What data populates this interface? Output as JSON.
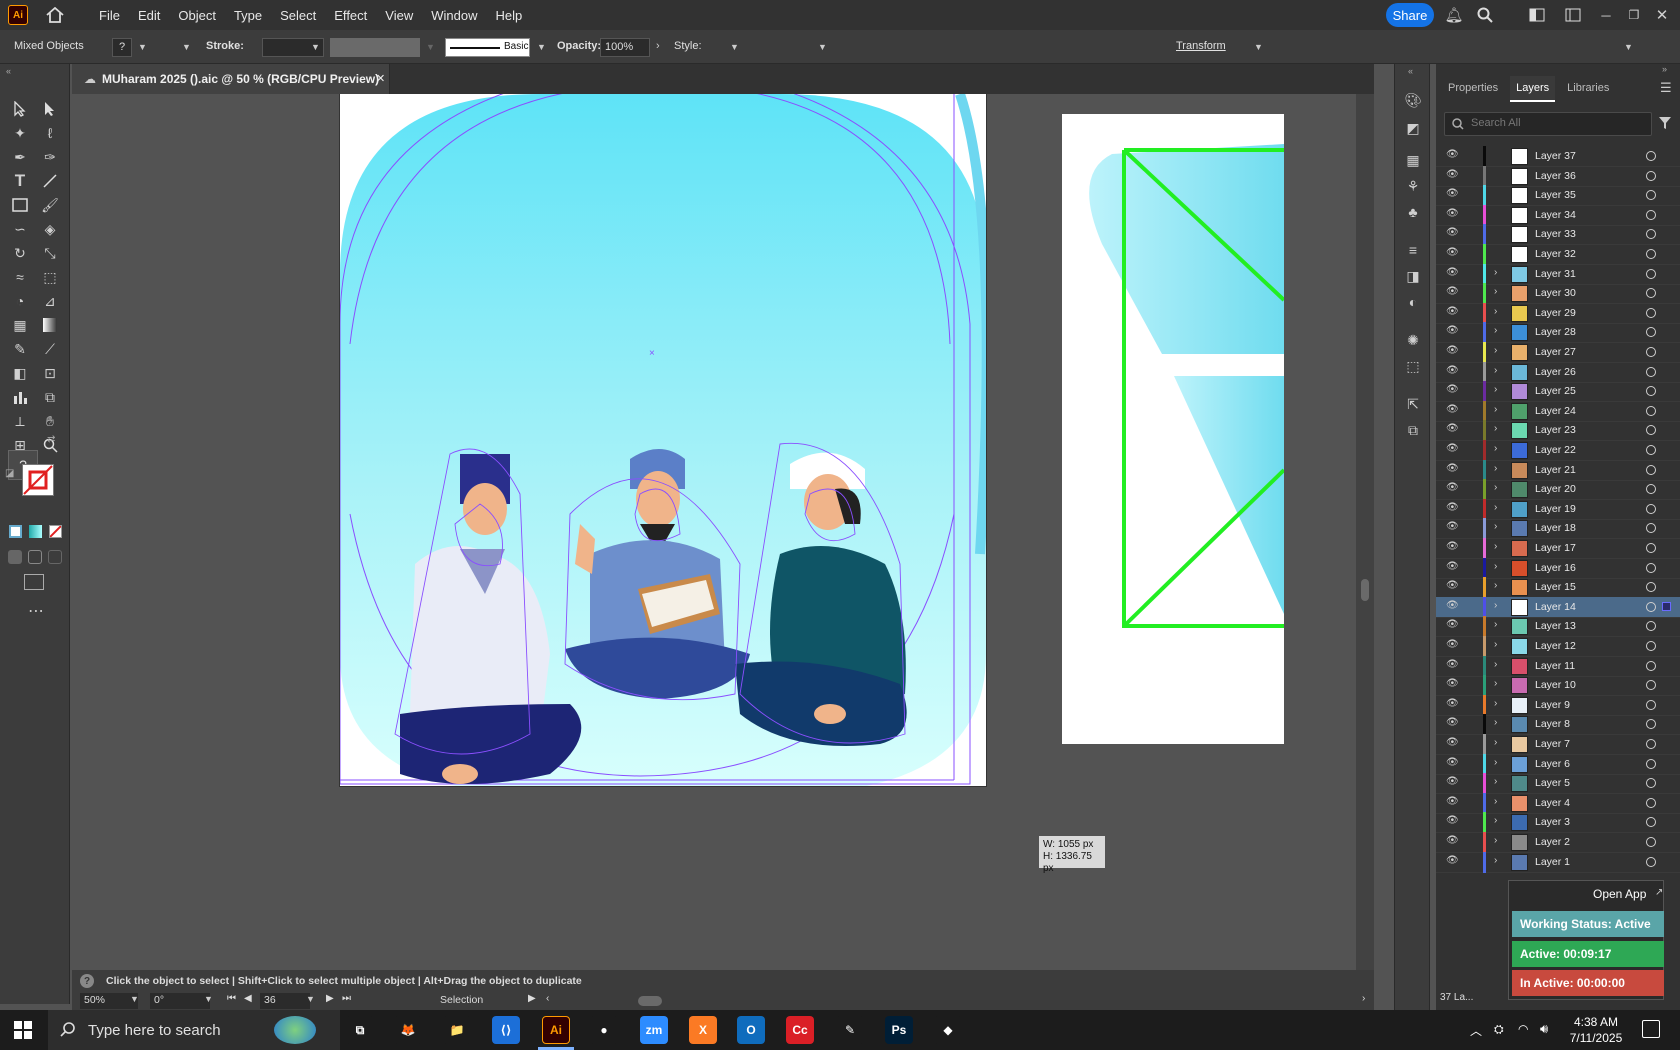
{
  "app": {
    "logo_text": "Ai",
    "menu": [
      "File",
      "Edit",
      "Object",
      "Type",
      "Select",
      "Effect",
      "View",
      "Window",
      "Help"
    ],
    "share_label": "Share"
  },
  "control_bar": {
    "selection_label": "Mixed Objects",
    "fill_placeholder": "?",
    "stroke_label": "Stroke:",
    "brush_label": "Basic",
    "opacity_label": "Opacity:",
    "opacity_value": "100%",
    "style_label": "Style:",
    "transform_label": "Transform"
  },
  "document": {
    "tab_title": "MUharam 2025 ().aic @ 50 % (RGB/CPU Preview)"
  },
  "size_tooltip": {
    "width": "W: 1055 px",
    "height": "H: 1336.75 px"
  },
  "status": {
    "hint": "Click the object to select  |  Shift+Click to select multiple object  |  Alt+Drag the object to duplicate",
    "zoom": "50%",
    "rotation": "0°",
    "artboard": "36",
    "tool": "Selection"
  },
  "panel": {
    "tabs": [
      "Properties",
      "Layers",
      "Libraries"
    ],
    "search_placeholder": "Search All",
    "layers_count": "37 La...",
    "layers": [
      {
        "name": "Layer 37",
        "color": "#0a0a0a",
        "expandable": false,
        "thumb": "#ffffff"
      },
      {
        "name": "Layer 36",
        "color": "#777777",
        "expandable": false,
        "thumb": "#ffffff"
      },
      {
        "name": "Layer 35",
        "color": "#4fd8e8",
        "expandable": false,
        "thumb": "#ffffff"
      },
      {
        "name": "Layer 34",
        "color": "#e84fd8",
        "expandable": false,
        "thumb": "#ffffff"
      },
      {
        "name": "Layer 33",
        "color": "#4f6be8",
        "expandable": false,
        "thumb": "#ffffff"
      },
      {
        "name": "Layer 32",
        "color": "#4fe84f",
        "expandable": false,
        "thumb": "#ffffff"
      },
      {
        "name": "Layer 31",
        "color": "#4fe8e8",
        "expandable": true,
        "thumb": "#7ec8e3"
      },
      {
        "name": "Layer 30",
        "color": "#4fe84f",
        "expandable": true,
        "thumb": "#e8a06b"
      },
      {
        "name": "Layer 29",
        "color": "#e84f4f",
        "expandable": true,
        "thumb": "#e8c84f"
      },
      {
        "name": "Layer 28",
        "color": "#4f6be8",
        "expandable": true,
        "thumb": "#3c8fd8"
      },
      {
        "name": "Layer 27",
        "color": "#e8e84f",
        "expandable": true,
        "thumb": "#e8b06b"
      },
      {
        "name": "Layer 26",
        "color": "#9a9a9a",
        "expandable": true,
        "thumb": "#6bb8d8"
      },
      {
        "name": "Layer 25",
        "color": "#6b2ba0",
        "expandable": true,
        "thumb": "#b08ad8"
      },
      {
        "name": "Layer 24",
        "color": "#a07a2b",
        "expandable": true,
        "thumb": "#4fa06b"
      },
      {
        "name": "Layer 23",
        "color": "#7a7a2b",
        "expandable": true,
        "thumb": "#6bd8b0"
      },
      {
        "name": "Layer 22",
        "color": "#a02b2b",
        "expandable": true,
        "thumb": "#3c6bd8"
      },
      {
        "name": "Layer 21",
        "color": "#2b8a8a",
        "expandable": true,
        "thumb": "#c88a5a"
      },
      {
        "name": "Layer 20",
        "color": "#7aa02b",
        "expandable": true,
        "thumb": "#4f8a6b"
      },
      {
        "name": "Layer 19",
        "color": "#c02b2b",
        "expandable": true,
        "thumb": "#4fa0c8"
      },
      {
        "name": "Layer 18",
        "color": "#8a9ad8",
        "expandable": true,
        "thumb": "#5a7ab0"
      },
      {
        "name": "Layer 17",
        "color": "#e86bd8",
        "expandable": true,
        "thumb": "#d86b4f"
      },
      {
        "name": "Layer 16",
        "color": "#1a1aa0",
        "expandable": true,
        "thumb": "#d84f2b"
      },
      {
        "name": "Layer 15",
        "color": "#e8a02b",
        "expandable": true,
        "thumb": "#e8904f"
      },
      {
        "name": "Layer 14",
        "color": "#4f4fe8",
        "expandable": true,
        "thumb": "#ffffff",
        "selected": true
      },
      {
        "name": "Layer 13",
        "color": "#c87a2b",
        "expandable": true,
        "thumb": "#6bc8b0"
      },
      {
        "name": "Layer 12",
        "color": "#c89a6b",
        "expandable": true,
        "thumb": "#8ad8e8"
      },
      {
        "name": "Layer 11",
        "color": "#2b8a7a",
        "expandable": true,
        "thumb": "#d84f6b"
      },
      {
        "name": "Layer 10",
        "color": "#2ba07a",
        "expandable": true,
        "thumb": "#c86bb0"
      },
      {
        "name": "Layer 9",
        "color": "#e87a2b",
        "expandable": true,
        "thumb": "#e8f0f8"
      },
      {
        "name": "Layer 8",
        "color": "#0a0a0a",
        "expandable": true,
        "thumb": "#5a8ab0"
      },
      {
        "name": "Layer 7",
        "color": "#9a9a9a",
        "expandable": true,
        "thumb": "#e8c8a0"
      },
      {
        "name": "Layer 6",
        "color": "#4fd8e8",
        "expandable": true,
        "thumb": "#6ba0d8"
      },
      {
        "name": "Layer 5",
        "color": "#e84fd8",
        "expandable": true,
        "thumb": "#4f8a8a"
      },
      {
        "name": "Layer 4",
        "color": "#4f6be8",
        "expandable": true,
        "thumb": "#e8906b"
      },
      {
        "name": "Layer 3",
        "color": "#4fe84f",
        "expandable": true,
        "thumb": "#3c6bb0"
      },
      {
        "name": "Layer 2",
        "color": "#e84f4f",
        "expandable": true,
        "thumb": "#8a8a8a"
      },
      {
        "name": "Layer 1",
        "color": "#4f6be8",
        "expandable": true,
        "thumb": "#5a7ab0"
      }
    ]
  },
  "timer_widget": {
    "open_app": "Open App",
    "working_status": "Working Status: Active",
    "active": "Active: 00:09:17",
    "inactive": "In Active: 00:00:00"
  },
  "taskbar": {
    "search_placeholder": "Type here to search",
    "time": "4:38 AM",
    "date": "7/11/2025",
    "apps": [
      {
        "name": "task-view",
        "label": "⧉",
        "color": "#1c1c1c"
      },
      {
        "name": "firefox",
        "label": "🦊",
        "color": "#1c1c1c"
      },
      {
        "name": "file-explorer",
        "label": "📁",
        "color": "#1c1c1c"
      },
      {
        "name": "vscode",
        "label": "⟨⟩",
        "color": "#1c6fd8"
      },
      {
        "name": "illustrator",
        "label": "Ai",
        "color": "#330000"
      },
      {
        "name": "chrome",
        "label": "●",
        "color": "#1c1c1c"
      },
      {
        "name": "zoom",
        "label": "zm",
        "color": "#2d8cff"
      },
      {
        "name": "xampp",
        "label": "X",
        "color": "#fb7a24"
      },
      {
        "name": "outlook",
        "label": "O",
        "color": "#0f6cbd"
      },
      {
        "name": "creative-cloud",
        "label": "Cc",
        "color": "#da1f26"
      },
      {
        "name": "inkscape",
        "label": "✎",
        "color": "#1c1c1c"
      },
      {
        "name": "photoshop",
        "label": "Ps",
        "color": "#001e36"
      },
      {
        "name": "other-app",
        "label": "◆",
        "color": "#1c1c1c"
      }
    ]
  }
}
